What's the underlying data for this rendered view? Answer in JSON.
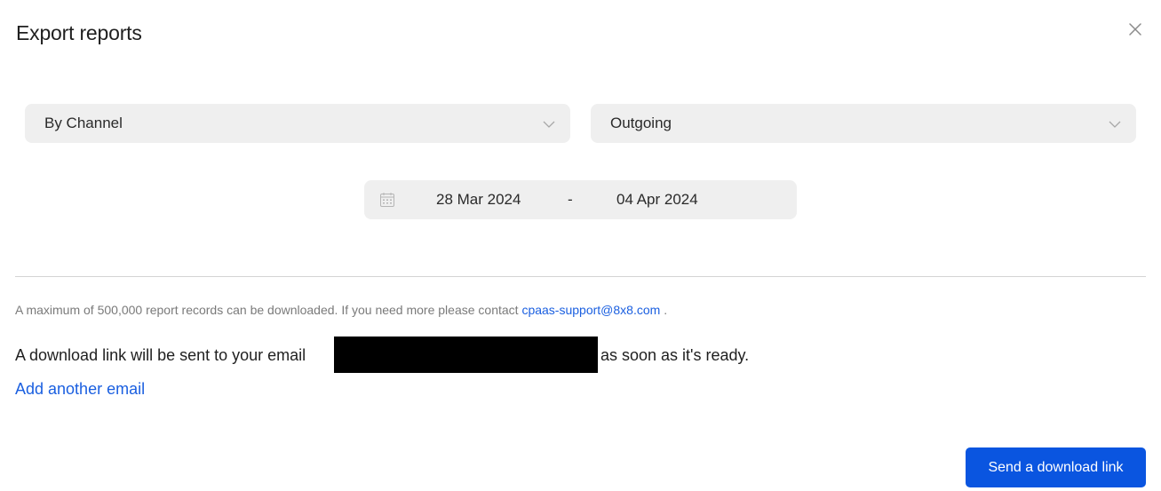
{
  "dialog": {
    "title": "Export reports",
    "close_icon": "close-icon"
  },
  "filters": {
    "group_by": {
      "value": "By Channel",
      "icon": "chevron-down-icon"
    },
    "direction": {
      "value": "Outgoing",
      "icon": "chevron-down-icon"
    }
  },
  "date_range": {
    "icon": "calendar-icon",
    "start": "28 Mar 2024",
    "separator": "-",
    "end": "04 Apr 2024"
  },
  "notice": {
    "text": "A maximum of 500,000 report records can be downloaded. If you need more please contact",
    "link": "cpaas-support@8x8.com",
    "suffix": "."
  },
  "email_info": {
    "prefix": "A download link will be sent to your email",
    "suffix": "as soon as it's ready."
  },
  "add_email_label": "Add another email",
  "send_button_label": "Send a download link",
  "colors": {
    "accent": "#0a55e0",
    "link": "#1a5fe0",
    "field_bg": "#efefef"
  }
}
